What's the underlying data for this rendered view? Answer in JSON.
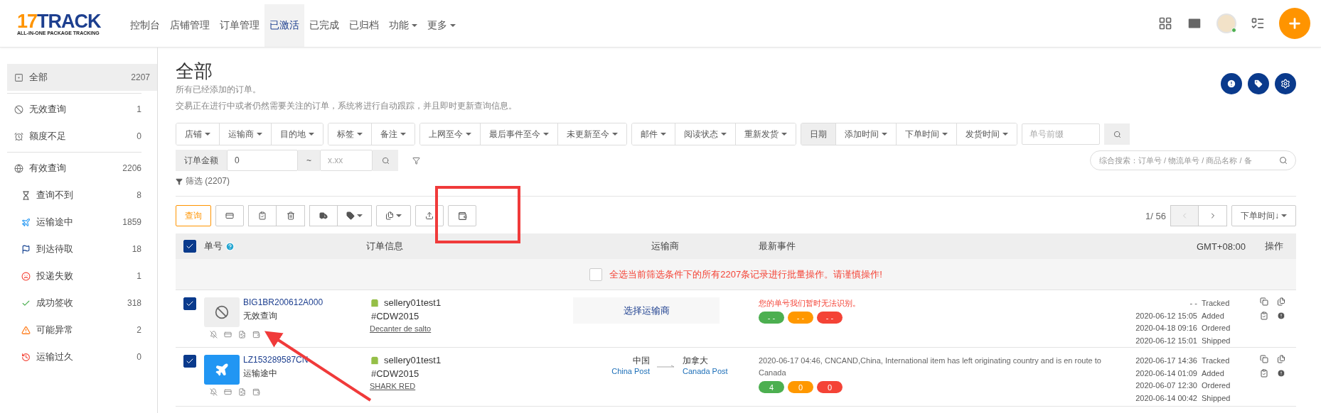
{
  "logo": {
    "mark": "17",
    "name": "TRACK",
    "tagline": "ALL-IN-ONE PACKAGE TRACKING"
  },
  "nav": [
    {
      "label": "控制台",
      "selected": false,
      "dropdown": false
    },
    {
      "label": "店铺管理",
      "selected": false,
      "dropdown": false
    },
    {
      "label": "订单管理",
      "selected": false,
      "dropdown": false
    },
    {
      "label": "已激活",
      "selected": true,
      "dropdown": false
    },
    {
      "label": "已完成",
      "selected": false,
      "dropdown": false
    },
    {
      "label": "已归档",
      "selected": false,
      "dropdown": false
    },
    {
      "label": "功能",
      "selected": false,
      "dropdown": true
    },
    {
      "label": "更多",
      "selected": false,
      "dropdown": true
    }
  ],
  "sidebar": {
    "groups": [
      [
        {
          "kind": "all",
          "label": "全部",
          "count": "2207",
          "selected": true
        }
      ],
      [
        {
          "kind": "invalid",
          "label": "无效查询",
          "count": "1",
          "selected": false
        },
        {
          "kind": "quota",
          "label": "额度不足",
          "count": "0",
          "selected": false
        }
      ],
      [
        {
          "kind": "valid",
          "label": "有效查询",
          "count": "2206",
          "selected": false,
          "children": [
            {
              "kind": "notfound",
              "label": "查询不到",
              "count": "8",
              "selected": false
            },
            {
              "kind": "transit",
              "label": "运输途中",
              "count": "1859",
              "selected": false
            },
            {
              "kind": "pickup",
              "label": "到达待取",
              "count": "18",
              "selected": false
            },
            {
              "kind": "failed",
              "label": "投递失败",
              "count": "1",
              "selected": false
            },
            {
              "kind": "delivered",
              "label": "成功签收",
              "count": "318",
              "selected": false
            },
            {
              "kind": "alert",
              "label": "可能异常",
              "count": "2",
              "selected": false
            },
            {
              "kind": "expired",
              "label": "运输过久",
              "count": "0",
              "selected": false
            }
          ]
        }
      ]
    ]
  },
  "page": {
    "title": "全部",
    "subtitle": "所有已经添加的订单。",
    "description": "交易正在进行中或者仍然需要关注的订单，系统将进行自动跟踪，并且即时更新查询信息。"
  },
  "filters": {
    "groups": [
      [
        "店铺",
        "运输商",
        "目的地"
      ],
      [
        "标签",
        "备注"
      ],
      [
        "上网至今",
        "最后事件至今",
        "未更新至今"
      ],
      [
        "邮件",
        "阅读状态",
        "重新发货"
      ]
    ],
    "date": {
      "label": "日期",
      "options": [
        "添加时间",
        "下单时间",
        "发货时间"
      ]
    },
    "prefix": {
      "placeholder": "单号前缀"
    },
    "amount": {
      "label": "订单金额",
      "min": "0",
      "separator": "~",
      "max_placeholder": "x.xx"
    },
    "search": {
      "placeholder": "综合搜索：订单号 / 物流单号 / 商品名称 / 备"
    },
    "summary": "筛选 (2207)"
  },
  "toolbar": {
    "query": "查询",
    "page": "1/ 56",
    "prev_disabled": true,
    "sort": "下单时间↓"
  },
  "table": {
    "all_checked": true,
    "columns": [
      "单号",
      "订单信息",
      "运输商",
      "最新事件",
      "GMT+08:00",
      "操作"
    ],
    "select_all": {
      "checked": false,
      "text": "全选当前筛选条件下的所有2207条记录进行批量操作。请谨慎操作!"
    },
    "rows": [
      {
        "checked": true,
        "status": {
          "kind": "invalid",
          "text": "无效查询"
        },
        "number": "BIG1BR200612A000",
        "store": "sellery01test1",
        "order": "#CDW2015",
        "product": "Decanter de salto",
        "carrier": {
          "kind": "select",
          "label": "选择运输商"
        },
        "event": {
          "kind": "error",
          "text": "您的单号我们暂时无法识别。"
        },
        "counts": [
          {
            "text": "- -",
            "color": "#4caf50"
          },
          {
            "text": "- -",
            "color": "#ff9800"
          },
          {
            "text": "- -",
            "color": "#f44336"
          }
        ],
        "times": [
          {
            "time": "- -",
            "label": "Tracked"
          },
          {
            "time": "2020-06-12 15:05",
            "label": "Added"
          },
          {
            "time": "2020-04-18 09:16",
            "label": "Ordered"
          },
          {
            "time": "2020-06-12 15:01",
            "label": "Shipped"
          }
        ]
      },
      {
        "checked": true,
        "status": {
          "kind": "transit",
          "text": "运输途中"
        },
        "number": "LZ153289587CN",
        "store": "sellery01test1",
        "order": "#CDW2015",
        "product": "SHARK RED",
        "carrier": {
          "kind": "route",
          "from": {
            "country": "中国",
            "carrier": "China Post"
          },
          "to": {
            "country": "加拿大",
            "carrier": "Canada Post"
          }
        },
        "event": {
          "kind": "info",
          "text": "2020-06-17 04:46, CNCAND,China, International item has left originating country and is en route to Canada"
        },
        "counts": [
          {
            "text": "4",
            "color": "#4caf50"
          },
          {
            "text": "0",
            "color": "#ff9800"
          },
          {
            "text": "0",
            "color": "#f44336"
          }
        ],
        "times": [
          {
            "time": "2020-06-17 14:36",
            "label": "Tracked"
          },
          {
            "time": "2020-06-14 01:09",
            "label": "Added"
          },
          {
            "time": "2020-06-07 12:30",
            "label": "Ordered"
          },
          {
            "time": "2020-06-14 00:42",
            "label": "Shipped"
          }
        ]
      }
    ]
  }
}
